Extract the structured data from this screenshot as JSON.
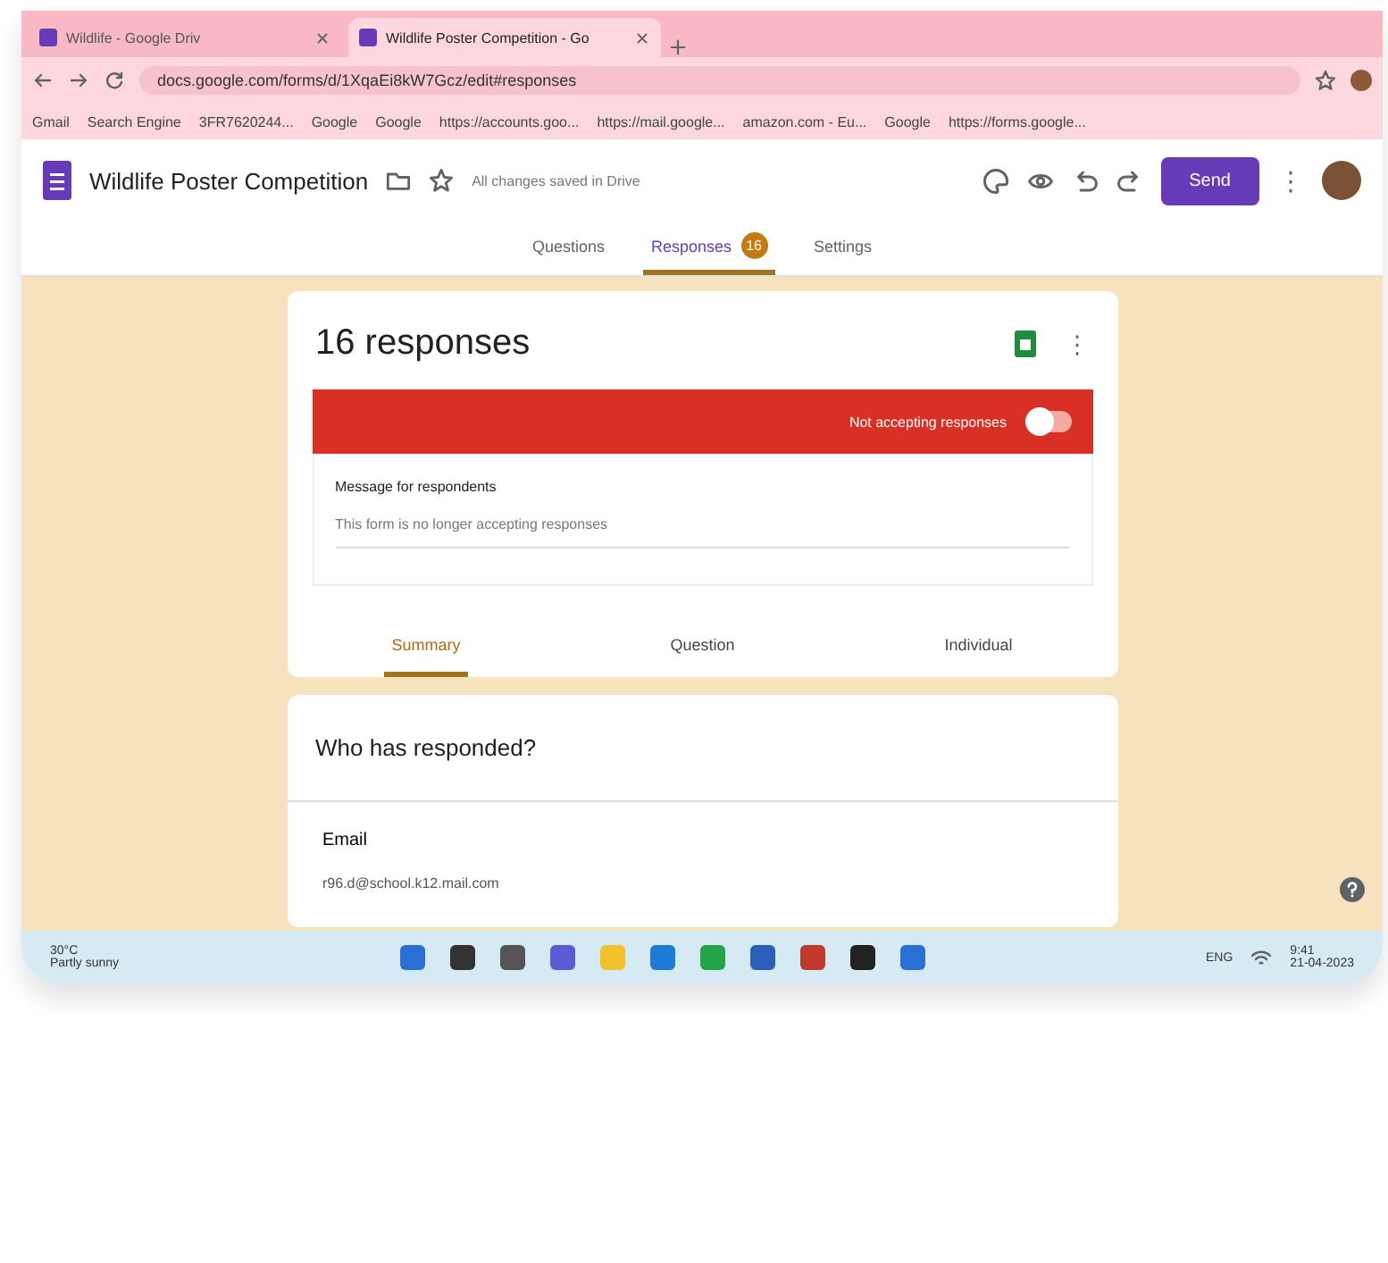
{
  "browser": {
    "tabs": [
      {
        "title": "Wildlife - Google Driv",
        "selected": false
      },
      {
        "title": "Wildlife Poster Competition - Go",
        "selected": true
      }
    ],
    "address": "docs.google.com/forms/d/1XqaEi8kW7Gcz/edit#responses",
    "bookmarks": [
      "Gmail",
      "Search Engine",
      "3FR7620244...",
      "Google",
      "Google",
      "https://accounts.goo...",
      "https://mail.google...",
      "amazon.com - Eu...",
      "Google",
      "https://forms.google..."
    ]
  },
  "form": {
    "title": "Wildlife Poster Competition",
    "save_status": "All changes saved in Drive",
    "send": "Send",
    "tabs": [
      {
        "label": "Questions",
        "selected": false
      },
      {
        "label": "Responses",
        "selected": true,
        "badge": "16"
      },
      {
        "label": "Settings",
        "selected": false
      }
    ]
  },
  "responses": {
    "heading": "16 responses",
    "accepting": {
      "label": "Not accepting responses",
      "on": false
    },
    "message_label": "Message for respondents",
    "message": "This form is no longer accepting responses",
    "views": [
      {
        "label": "Summary",
        "selected": true
      },
      {
        "label": "Question",
        "selected": false
      },
      {
        "label": "Individual",
        "selected": false
      }
    ]
  },
  "who": {
    "heading": "Who has responded?",
    "column": "Email",
    "first_row": "r96.d@school.k12.mail.com"
  },
  "taskbar": {
    "weather": {
      "temp": "30°C",
      "condition": "Partly sunny"
    },
    "lang": "ENG",
    "time": "9:41",
    "date": "21-04-2023"
  }
}
